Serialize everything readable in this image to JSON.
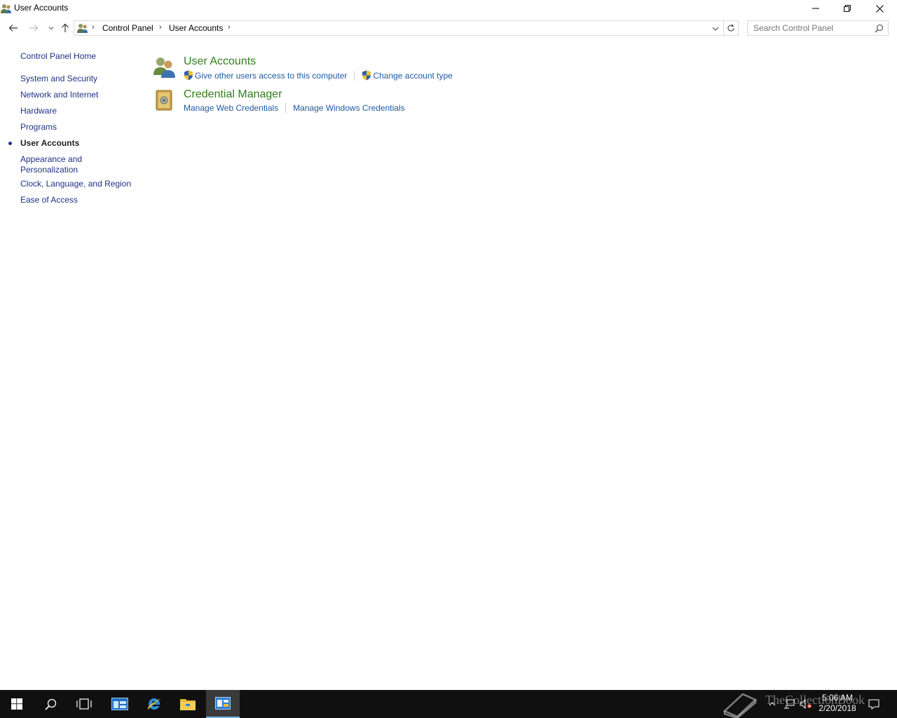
{
  "window": {
    "title": "User Accounts"
  },
  "address": {
    "crumbs": [
      "Control Panel",
      "User Accounts"
    ]
  },
  "search": {
    "placeholder": "Search Control Panel"
  },
  "sidebar": {
    "home": "Control Panel Home",
    "items": [
      {
        "label": "System and Security"
      },
      {
        "label": "Network and Internet"
      },
      {
        "label": "Hardware"
      },
      {
        "label": "Programs"
      },
      {
        "label": "User Accounts",
        "current": true
      },
      {
        "label": "Appearance and Personalization"
      },
      {
        "label": "Clock, Language, and Region"
      },
      {
        "label": "Ease of Access"
      }
    ]
  },
  "main": {
    "groups": [
      {
        "title": "User Accounts",
        "icon": "users-icon",
        "links": [
          {
            "label": "Give other users access to this computer",
            "shield": true
          },
          {
            "label": "Change account type",
            "shield": true
          }
        ]
      },
      {
        "title": "Credential Manager",
        "icon": "credential-vault-icon",
        "links": [
          {
            "label": "Manage Web Credentials",
            "shield": false
          },
          {
            "label": "Manage Windows Credentials",
            "shield": false
          }
        ]
      }
    ]
  },
  "taskbar": {
    "clock_time": "5:06 AM",
    "clock_date": "2/20/2018",
    "watermark": "TheCollectionBook",
    "apps": [
      "start-icon",
      "search-icon",
      "task-view-icon",
      "server-manager-icon",
      "internet-explorer-icon",
      "file-explorer-icon",
      "control-panel-icon"
    ]
  },
  "colors": {
    "link": "#1e5aa0",
    "nav_link": "#1e3287",
    "group_title": "#2f7d1a",
    "taskbar": "#101010"
  }
}
